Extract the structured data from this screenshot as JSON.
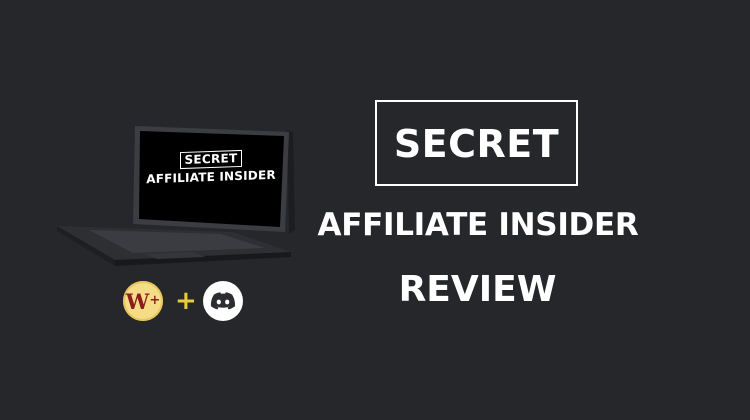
{
  "colors": {
    "background": "#25272b",
    "text": "#ffffff",
    "w_badge_fill": "#f4dd86",
    "w_badge_letter": "#8c1d1d",
    "plus": "#e8cc3c",
    "discord_badge": "#ffffff",
    "discord_glyph": "#2b2d31"
  },
  "device_screen": {
    "boxed_word": "SECRET",
    "subtitle": "AFFILIATE INSIDER"
  },
  "icons": {
    "left_badge_letter": "W",
    "left_badge_superscript": "+",
    "left_badge_icon": "warrior-plus-logo-icon",
    "separator": "+",
    "right_badge_icon": "discord-logo-icon"
  },
  "title": {
    "boxed_word": "SECRET",
    "line2": "AFFILIATE INSIDER",
    "line3": "REVIEW"
  }
}
